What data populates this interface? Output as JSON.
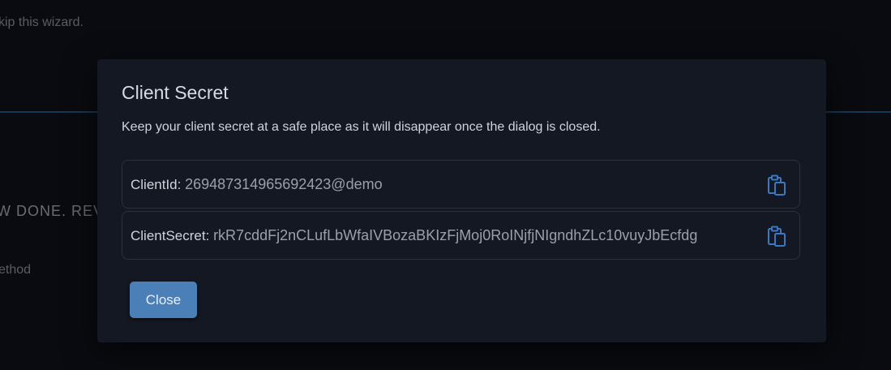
{
  "background": {
    "wizard_text": "kip this wizard.",
    "done_text": "W DONE. REV",
    "method_text": "ethod"
  },
  "dialog": {
    "title": "Client Secret",
    "description": "Keep your client secret at a safe place as it will disappear once the dialog is closed.",
    "client_id": {
      "label": "ClientId:",
      "value": "269487314965692423@demo",
      "copy_icon": "clipboard-icon"
    },
    "client_secret": {
      "label": "ClientSecret:",
      "value": "rkR7cddFj2nCLufLbWfaIVBozaBKIzFjMoj0RoINjfjNIgndhZLc10vuyJbEcfdg",
      "copy_icon": "clipboard-icon"
    },
    "close_label": "Close"
  },
  "colors": {
    "accent": "#4a7fb8",
    "icon": "#3a78c2",
    "dialog_bg": "#141822"
  }
}
